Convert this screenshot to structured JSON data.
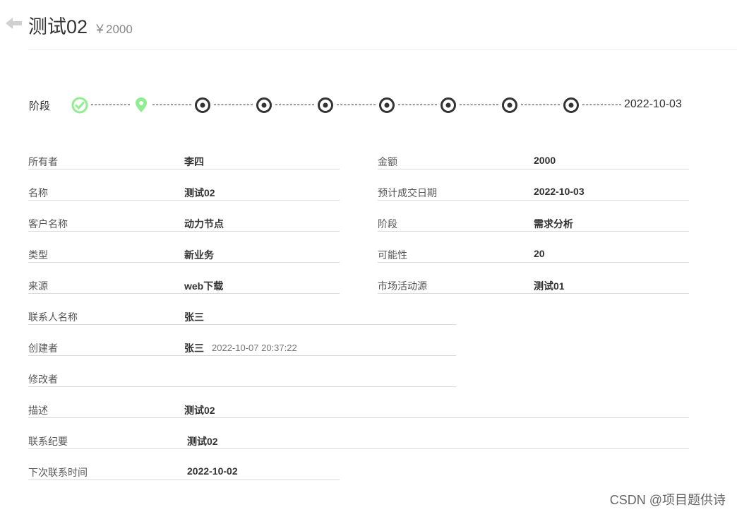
{
  "header": {
    "title": "测试02",
    "price": "￥2000"
  },
  "stage": {
    "label": "阶段",
    "date": "2022-10-03",
    "steps": [
      "completed",
      "current",
      "pending",
      "pending",
      "pending",
      "pending",
      "pending",
      "pending",
      "pending"
    ]
  },
  "fields": {
    "owner": {
      "label": "所有者",
      "value": "李四"
    },
    "amount": {
      "label": "金额",
      "value": "2000"
    },
    "name": {
      "label": "名称",
      "value": "测试02"
    },
    "expected_date": {
      "label": "预计成交日期",
      "value": "2022-10-03"
    },
    "customer": {
      "label": "客户名称",
      "value": "动力节点"
    },
    "stage": {
      "label": "阶段",
      "value": "需求分析"
    },
    "type": {
      "label": "类型",
      "value": "新业务"
    },
    "possibility": {
      "label": "可能性",
      "value": "20"
    },
    "source": {
      "label": "来源",
      "value": "web下载"
    },
    "activity_source": {
      "label": "市场活动源",
      "value": "测试01"
    },
    "contact": {
      "label": "联系人名称",
      "value": "张三"
    },
    "create_by": {
      "label": "创建者",
      "value": "张三",
      "time": "2022-10-07 20:37:22"
    },
    "edit_by": {
      "label": "修改者",
      "value": ""
    },
    "description": {
      "label": "描述",
      "value": "测试02"
    },
    "contact_summary": {
      "label": "联系纪要",
      "value": "测试02"
    },
    "next_contact_time": {
      "label": "下次联系时间",
      "value": "2022-10-02"
    }
  },
  "colors": {
    "completed": "#90EE90",
    "pending": "#333333"
  },
  "watermark": "CSDN @项目题供诗"
}
